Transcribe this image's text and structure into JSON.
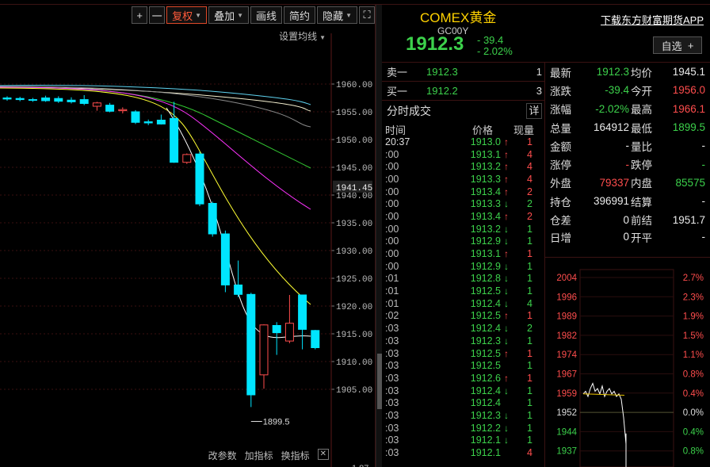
{
  "toolbar": {
    "plus": "+",
    "minus": "一",
    "adjust": "复权",
    "overlay": "叠加",
    "draw": "画线",
    "simple": "简约",
    "hide": "隐藏",
    "fullscreen": "⛶"
  },
  "ma_setting": "设置均线",
  "bottom_links": {
    "params": "改参数",
    "add": "加指标",
    "swap": "换指标",
    "close": "✕"
  },
  "axis_bottom_partial": "1.87",
  "chart_data": {
    "type": "candlestick",
    "y_ticks": [
      1960.0,
      1955.0,
      1950.0,
      1945.0,
      1940.0,
      1935.0,
      1930.0,
      1925.0,
      1920.0,
      1915.0,
      1910.0,
      1905.0
    ],
    "y_tick_labels": [
      "1960.00",
      "1955.00",
      "1950.00",
      "1945.00",
      "1940.00",
      "1935.00",
      "1930.00",
      "1925.00",
      "1920.00",
      "1915.00",
      "1910.00",
      "1905.00"
    ],
    "current_label": "1941.45",
    "low_label": "1899.5",
    "ylim": [
      1901.5,
      1963.0
    ],
    "candles": [
      {
        "o": 1957.5,
        "h": 1957.8,
        "l": 1957.0,
        "c": 1957.3
      },
      {
        "o": 1957.4,
        "h": 1957.7,
        "l": 1956.9,
        "c": 1957.2
      },
      {
        "o": 1957.2,
        "h": 1957.5,
        "l": 1956.8,
        "c": 1957.1
      },
      {
        "o": 1957.5,
        "h": 1957.9,
        "l": 1956.8,
        "c": 1957.0
      },
      {
        "o": 1957.4,
        "h": 1957.8,
        "l": 1956.6,
        "c": 1956.9
      },
      {
        "o": 1957.1,
        "h": 1957.6,
        "l": 1956.5,
        "c": 1956.8
      },
      {
        "o": 1957.2,
        "h": 1958.0,
        "l": 1956.2,
        "c": 1956.5
      },
      {
        "o": 1956.0,
        "h": 1956.8,
        "l": 1955.2,
        "c": 1956.6
      },
      {
        "o": 1956.2,
        "h": 1956.6,
        "l": 1954.9,
        "c": 1955.1
      },
      {
        "o": 1955.2,
        "h": 1955.8,
        "l": 1954.7,
        "c": 1955.4
      },
      {
        "o": 1955.0,
        "h": 1955.3,
        "l": 1952.8,
        "c": 1953.1
      },
      {
        "o": 1953.2,
        "h": 1953.6,
        "l": 1952.6,
        "c": 1953.0
      },
      {
        "o": 1953.5,
        "h": 1954.5,
        "l": 1952.7,
        "c": 1952.8
      },
      {
        "o": 1953.8,
        "h": 1956.8,
        "l": 1945.8,
        "c": 1945.9
      },
      {
        "o": 1945.9,
        "h": 1947.5,
        "l": 1945.6,
        "c": 1947.3
      },
      {
        "o": 1947.4,
        "h": 1947.8,
        "l": 1938.0,
        "c": 1938.4
      },
      {
        "o": 1938.5,
        "h": 1938.8,
        "l": 1932.5,
        "c": 1933.0
      },
      {
        "o": 1933.0,
        "h": 1933.6,
        "l": 1922.5,
        "c": 1923.8
      },
      {
        "o": 1923.8,
        "h": 1928.2,
        "l": 1921.6,
        "c": 1922.1
      },
      {
        "o": 1922.1,
        "h": 1922.4,
        "l": 1901.8,
        "c": 1904.0
      },
      {
        "o": 1907.6,
        "h": 1916.7,
        "l": 1905.1,
        "c": 1916.6
      },
      {
        "o": 1916.5,
        "h": 1917.1,
        "l": 1911.2,
        "c": 1915.2
      },
      {
        "o": 1913.7,
        "h": 1922.0,
        "l": 1913.3,
        "c": 1916.9
      },
      {
        "o": 1922.0,
        "h": 1922.0,
        "l": 1912.2,
        "c": 1915.8
      },
      {
        "o": 1915.6,
        "h": 1915.7,
        "l": 1912.2,
        "c": 1912.5
      }
    ],
    "ma_colors": [
      "#ffffff",
      "#ffff33",
      "#ff33ff",
      "#33cc33",
      "#f5f0d0",
      "#5fd3f0"
    ]
  },
  "instrument": {
    "name": "COMEX黄金",
    "code": "GC00Y",
    "price": "1912.3",
    "change": "- 39.4",
    "change_pct": "- 2.02%",
    "app_link": "下载东方财富期货APP",
    "watch": "自选",
    "watch_plus": "+"
  },
  "orderbook": [
    {
      "label": "卖一",
      "price": "1912.3",
      "vol": "1"
    },
    {
      "label": "买一",
      "price": "1912.2",
      "vol": "3"
    }
  ],
  "ticks_title": "分时成交",
  "ticks_detail": "详",
  "ticks_head": {
    "time": "时间",
    "price": "价格",
    "vol": "现量"
  },
  "ticks": [
    {
      "t": "20:37",
      "p": "1913.0",
      "d": "up",
      "v": "1"
    },
    {
      "t": ":00",
      "p": "1913.1",
      "d": "up",
      "v": "4"
    },
    {
      "t": ":00",
      "p": "1913.2",
      "d": "up",
      "v": "4"
    },
    {
      "t": ":00",
      "p": "1913.3",
      "d": "up",
      "v": "4"
    },
    {
      "t": ":00",
      "p": "1913.4",
      "d": "up",
      "v": "2"
    },
    {
      "t": ":00",
      "p": "1913.3",
      "d": "down",
      "v": "2"
    },
    {
      "t": ":00",
      "p": "1913.4",
      "d": "up",
      "v": "2"
    },
    {
      "t": ":00",
      "p": "1913.2",
      "d": "down",
      "v": "1"
    },
    {
      "t": ":00",
      "p": "1912.9",
      "d": "down",
      "v": "1"
    },
    {
      "t": ":00",
      "p": "1913.1",
      "d": "up",
      "v": "1"
    },
    {
      "t": ":00",
      "p": "1912.9",
      "d": "down",
      "v": "1"
    },
    {
      "t": ":01",
      "p": "1912.8",
      "d": "down",
      "v": "1"
    },
    {
      "t": ":01",
      "p": "1912.5",
      "d": "down",
      "v": "1"
    },
    {
      "t": ":01",
      "p": "1912.4",
      "d": "down",
      "v": "4"
    },
    {
      "t": ":02",
      "p": "1912.5",
      "d": "up",
      "v": "1"
    },
    {
      "t": ":03",
      "p": "1912.4",
      "d": "down",
      "v": "2"
    },
    {
      "t": ":03",
      "p": "1912.3",
      "d": "down",
      "v": "1"
    },
    {
      "t": ":03",
      "p": "1912.5",
      "d": "up",
      "v": "1"
    },
    {
      "t": ":03",
      "p": "1912.5",
      "d": "",
      "v": "1"
    },
    {
      "t": ":03",
      "p": "1912.6",
      "d": "up",
      "v": "1"
    },
    {
      "t": ":03",
      "p": "1912.4",
      "d": "down",
      "v": "1"
    },
    {
      "t": ":03",
      "p": "1912.4",
      "d": "",
      "v": "1"
    },
    {
      "t": ":03",
      "p": "1912.3",
      "d": "down",
      "v": "1"
    },
    {
      "t": ":03",
      "p": "1912.2",
      "d": "down",
      "v": "1"
    },
    {
      "t": ":03",
      "p": "1912.1",
      "d": "down",
      "v": "1"
    },
    {
      "t": ":03",
      "p": "1912.1",
      "d": "",
      "v": "4"
    }
  ],
  "stats": [
    {
      "k1": "最新",
      "v1": "1912.3",
      "c1": "green",
      "k2": "均价",
      "v2": "1945.1",
      "c2": "white"
    },
    {
      "k1": "涨跌",
      "v1": "-39.4",
      "c1": "green",
      "k2": "今开",
      "v2": "1956.0",
      "c2": "red"
    },
    {
      "k1": "涨幅",
      "v1": "-2.02%",
      "c1": "green",
      "k2": "最高",
      "v2": "1966.1",
      "c2": "red"
    },
    {
      "k1": "总量",
      "v1": "164912",
      "c1": "white",
      "k2": "最低",
      "v2": "1899.5",
      "c2": "green"
    },
    {
      "k1": "金额",
      "v1": "-",
      "c1": "white",
      "k2": "量比",
      "v2": "-",
      "c2": "white"
    },
    {
      "k1": "涨停",
      "v1": "-",
      "c1": "red",
      "k2": "跌停",
      "v2": "-",
      "c2": "green"
    },
    {
      "k1": "外盘",
      "v1": "79337",
      "c1": "red",
      "k2": "内盘",
      "v2": "85575",
      "c2": "green"
    },
    {
      "k1": "持仓",
      "v1": "396991",
      "c1": "white",
      "k2": "结算",
      "v2": "-",
      "c2": "white"
    },
    {
      "k1": "仓差",
      "v1": "0",
      "c1": "white",
      "k2": "前结",
      "v2": "1951.7",
      "c2": "white"
    },
    {
      "k1": "日增",
      "v1": "0",
      "c1": "white",
      "k2": "开平",
      "v2": "-",
      "c2": "white"
    }
  ],
  "mini_chart": {
    "left_labels": [
      "2004",
      "1996",
      "1989",
      "1982",
      "1974",
      "1967",
      "1959",
      "1952",
      "1944",
      "1937"
    ],
    "right_labels": [
      "2.7%",
      "2.3%",
      "1.9%",
      "1.5%",
      "1.1%",
      "0.8%",
      "0.4%",
      "0.0%",
      "0.4%",
      "0.8%"
    ],
    "prices": [
      1959,
      1960,
      1958,
      1961,
      1963,
      1960,
      1961,
      1959,
      1962,
      1958,
      1960,
      1961,
      1959,
      1960,
      1958,
      1959,
      1957,
      1950,
      1940
    ]
  }
}
